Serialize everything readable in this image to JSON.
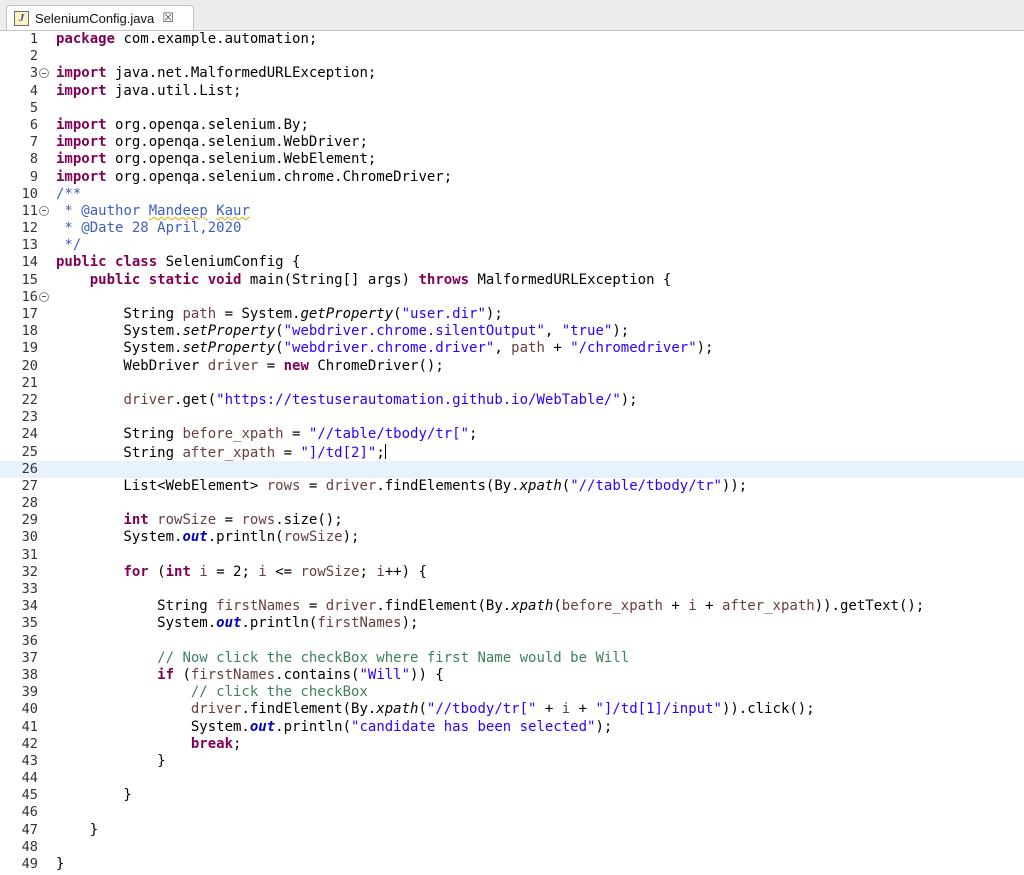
{
  "tab": {
    "title": "SeleniumConfig.java",
    "icon": "java-file-icon",
    "close_icon": "close-icon"
  },
  "colors": {
    "keyword": "#7f0055",
    "string": "#2a00ff",
    "comment": "#3f7f5f",
    "javadoc": "#3f5fbf",
    "local_variable": "#6a3e3e",
    "static_field": "#0000c0",
    "current_line": "#e8f2fe"
  },
  "editor": {
    "current_line": 26,
    "fold_lines": [
      3,
      11,
      16
    ],
    "lines": [
      [
        {
          "t": "package",
          "c": "kw"
        },
        {
          "t": " com.example.automation;"
        }
      ],
      [],
      [
        {
          "t": "import",
          "c": "kw"
        },
        {
          "t": " java.net.MalformedURLException;"
        }
      ],
      [
        {
          "t": "import",
          "c": "kw"
        },
        {
          "t": " java.util.List;"
        }
      ],
      [],
      [
        {
          "t": "import",
          "c": "kw"
        },
        {
          "t": " org.openqa.selenium.By;"
        }
      ],
      [
        {
          "t": "import",
          "c": "kw"
        },
        {
          "t": " org.openqa.selenium.WebDriver;"
        }
      ],
      [
        {
          "t": "import",
          "c": "kw"
        },
        {
          "t": " org.openqa.selenium.WebElement;"
        }
      ],
      [
        {
          "t": "import",
          "c": "kw"
        },
        {
          "t": " org.openqa.selenium.chrome.ChromeDriver;"
        }
      ],
      [
        {
          "t": "/**",
          "c": "jd"
        }
      ],
      [
        {
          "t": " * ",
          "c": "jd"
        },
        {
          "t": "@author",
          "c": "jd"
        },
        {
          "t": " ",
          "c": "jd"
        },
        {
          "t": "Mandeep",
          "c": "jd sq"
        },
        {
          "t": " ",
          "c": "jd"
        },
        {
          "t": "Kaur",
          "c": "jd sq"
        }
      ],
      [
        {
          "t": " * ",
          "c": "jd"
        },
        {
          "t": "@Date",
          "c": "jd"
        },
        {
          "t": " 28 April,2020",
          "c": "jd"
        }
      ],
      [
        {
          "t": " */",
          "c": "jd"
        }
      ],
      [
        {
          "t": "public",
          "c": "kw"
        },
        {
          "t": " "
        },
        {
          "t": "class",
          "c": "kw"
        },
        {
          "t": " SeleniumConfig {"
        }
      ],
      [
        {
          "t": "    "
        },
        {
          "t": "public",
          "c": "kw"
        },
        {
          "t": " "
        },
        {
          "t": "static",
          "c": "kw"
        },
        {
          "t": " "
        },
        {
          "t": "void",
          "c": "kw"
        },
        {
          "t": " main(String[] args) "
        },
        {
          "t": "throws",
          "c": "kw"
        },
        {
          "t": " MalformedURLException {"
        }
      ],
      [],
      [
        {
          "t": "        String "
        },
        {
          "t": "path",
          "c": "var"
        },
        {
          "t": " = System."
        },
        {
          "t": "getProperty",
          "c": "it"
        },
        {
          "t": "("
        },
        {
          "t": "\"user.dir\"",
          "c": "str"
        },
        {
          "t": ");"
        }
      ],
      [
        {
          "t": "        System."
        },
        {
          "t": "setProperty",
          "c": "it"
        },
        {
          "t": "("
        },
        {
          "t": "\"webdriver.chrome.silentOutput\"",
          "c": "str"
        },
        {
          "t": ", "
        },
        {
          "t": "\"true\"",
          "c": "str"
        },
        {
          "t": ");"
        }
      ],
      [
        {
          "t": "        System."
        },
        {
          "t": "setProperty",
          "c": "it"
        },
        {
          "t": "("
        },
        {
          "t": "\"webdriver.chrome.driver\"",
          "c": "str"
        },
        {
          "t": ", "
        },
        {
          "t": "path",
          "c": "var"
        },
        {
          "t": " + "
        },
        {
          "t": "\"/chromedriver\"",
          "c": "str"
        },
        {
          "t": ");"
        }
      ],
      [
        {
          "t": "        WebDriver "
        },
        {
          "t": "driver",
          "c": "var"
        },
        {
          "t": " = "
        },
        {
          "t": "new",
          "c": "kw"
        },
        {
          "t": " ChromeDriver();"
        }
      ],
      [],
      [
        {
          "t": "        "
        },
        {
          "t": "driver",
          "c": "var"
        },
        {
          "t": ".get("
        },
        {
          "t": "\"https://testuserautomation.github.io/WebTable/\"",
          "c": "str"
        },
        {
          "t": ");"
        }
      ],
      [],
      [
        {
          "t": "        String "
        },
        {
          "t": "before_xpath",
          "c": "var"
        },
        {
          "t": " = "
        },
        {
          "t": "\"//table/tbody/tr[\"",
          "c": "str"
        },
        {
          "t": ";"
        }
      ],
      [
        {
          "t": "        String "
        },
        {
          "t": "after_xpath",
          "c": "var"
        },
        {
          "t": " = "
        },
        {
          "t": "\"]/td[2]\"",
          "c": "str"
        },
        {
          "t": ";"
        },
        {
          "t": "",
          "c": "caret"
        }
      ],
      [],
      [
        {
          "t": "        List<WebElement> "
        },
        {
          "t": "rows",
          "c": "var"
        },
        {
          "t": " = "
        },
        {
          "t": "driver",
          "c": "var"
        },
        {
          "t": ".findElements(By."
        },
        {
          "t": "xpath",
          "c": "it"
        },
        {
          "t": "("
        },
        {
          "t": "\"//table/tbody/tr\"",
          "c": "str"
        },
        {
          "t": "));"
        }
      ],
      [],
      [
        {
          "t": "        "
        },
        {
          "t": "int",
          "c": "kw"
        },
        {
          "t": " "
        },
        {
          "t": "rowSize",
          "c": "var"
        },
        {
          "t": " = "
        },
        {
          "t": "rows",
          "c": "var"
        },
        {
          "t": ".size();"
        }
      ],
      [
        {
          "t": "        System."
        },
        {
          "t": "out",
          "c": "fld"
        },
        {
          "t": ".println("
        },
        {
          "t": "rowSize",
          "c": "var"
        },
        {
          "t": ");"
        }
      ],
      [],
      [
        {
          "t": "        "
        },
        {
          "t": "for",
          "c": "kw"
        },
        {
          "t": " ("
        },
        {
          "t": "int",
          "c": "kw"
        },
        {
          "t": " "
        },
        {
          "t": "i",
          "c": "var"
        },
        {
          "t": " = 2; "
        },
        {
          "t": "i",
          "c": "var"
        },
        {
          "t": " <= "
        },
        {
          "t": "rowSize",
          "c": "var"
        },
        {
          "t": "; "
        },
        {
          "t": "i",
          "c": "var"
        },
        {
          "t": "++) {"
        }
      ],
      [],
      [
        {
          "t": "            String "
        },
        {
          "t": "firstNames",
          "c": "var"
        },
        {
          "t": " = "
        },
        {
          "t": "driver",
          "c": "var"
        },
        {
          "t": ".findElement(By."
        },
        {
          "t": "xpath",
          "c": "it"
        },
        {
          "t": "("
        },
        {
          "t": "before_xpath",
          "c": "var"
        },
        {
          "t": " + "
        },
        {
          "t": "i",
          "c": "var"
        },
        {
          "t": " + "
        },
        {
          "t": "after_xpath",
          "c": "var"
        },
        {
          "t": ")).getText();"
        }
      ],
      [
        {
          "t": "            System."
        },
        {
          "t": "out",
          "c": "fld"
        },
        {
          "t": ".println("
        },
        {
          "t": "firstNames",
          "c": "var"
        },
        {
          "t": ");"
        }
      ],
      [],
      [
        {
          "t": "            "
        },
        {
          "t": "// Now click the checkBox where first Name would be Will",
          "c": "cm"
        }
      ],
      [
        {
          "t": "            "
        },
        {
          "t": "if",
          "c": "kw"
        },
        {
          "t": " ("
        },
        {
          "t": "firstNames",
          "c": "var"
        },
        {
          "t": ".contains("
        },
        {
          "t": "\"Will\"",
          "c": "str"
        },
        {
          "t": ")) {"
        }
      ],
      [
        {
          "t": "                "
        },
        {
          "t": "// click the checkBox",
          "c": "cm"
        }
      ],
      [
        {
          "t": "                "
        },
        {
          "t": "driver",
          "c": "var"
        },
        {
          "t": ".findElement(By."
        },
        {
          "t": "xpath",
          "c": "it"
        },
        {
          "t": "("
        },
        {
          "t": "\"//tbody/tr[\"",
          "c": "str"
        },
        {
          "t": " + "
        },
        {
          "t": "i",
          "c": "var"
        },
        {
          "t": " + "
        },
        {
          "t": "\"]/td[1]/input\"",
          "c": "str"
        },
        {
          "t": ")).click();"
        }
      ],
      [
        {
          "t": "                System."
        },
        {
          "t": "out",
          "c": "fld"
        },
        {
          "t": ".println("
        },
        {
          "t": "\"candidate has been selected\"",
          "c": "str"
        },
        {
          "t": ");"
        }
      ],
      [
        {
          "t": "                "
        },
        {
          "t": "break",
          "c": "kw"
        },
        {
          "t": ";"
        }
      ],
      [
        {
          "t": "            }"
        }
      ],
      [],
      [
        {
          "t": "        }"
        }
      ],
      [],
      [
        {
          "t": "    }"
        }
      ],
      [],
      [
        {
          "t": "}"
        }
      ]
    ]
  }
}
